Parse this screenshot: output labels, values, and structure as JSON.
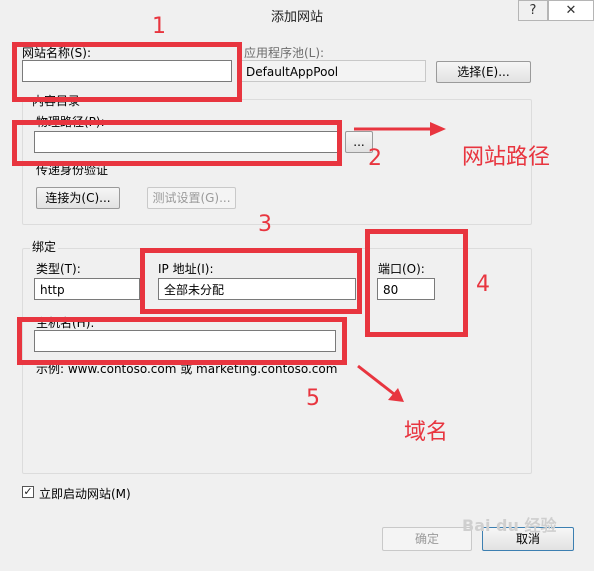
{
  "window": {
    "title": "添加网站",
    "help_glyph": "?",
    "close_glyph": "✕"
  },
  "site_name": {
    "label": "网站名称(S):",
    "value": ""
  },
  "app_pool": {
    "label": "应用程序池(L):",
    "value": "DefaultAppPool",
    "select_label": "选择(E)..."
  },
  "content_dir": {
    "group_label": "内容目录",
    "physical_path_label": "物理路径(P):",
    "physical_path_value": "",
    "browse_label": "...",
    "auth_label": "传递身份验证",
    "connect_as_label": "连接为(C)...",
    "test_settings_label": "测试设置(G)..."
  },
  "binding": {
    "group_label": "绑定",
    "type_label": "类型(T):",
    "type_value": "http",
    "ip_label": "IP 地址(I):",
    "ip_value": "全部未分配",
    "port_label": "端口(O):",
    "port_value": "80",
    "host_label": "主机名(H):",
    "host_value": "",
    "example_text": "示例: www.contoso.com 或 marketing.contoso.com"
  },
  "start_now": {
    "label": "立即启动网站(M)",
    "checked": true,
    "mark": "✓"
  },
  "footer": {
    "ok_label": "确定",
    "cancel_label": "取消"
  },
  "annotations": {
    "num1": "1",
    "num2": "2",
    "num3": "3",
    "num4": "4",
    "num5": "5",
    "site_path_text": "网站路径",
    "domain_text": "域名"
  },
  "watermark": "Bai du 经验",
  "colors": {
    "annotation_red": "#e8353f",
    "window_bg": "#f0f0f0"
  }
}
